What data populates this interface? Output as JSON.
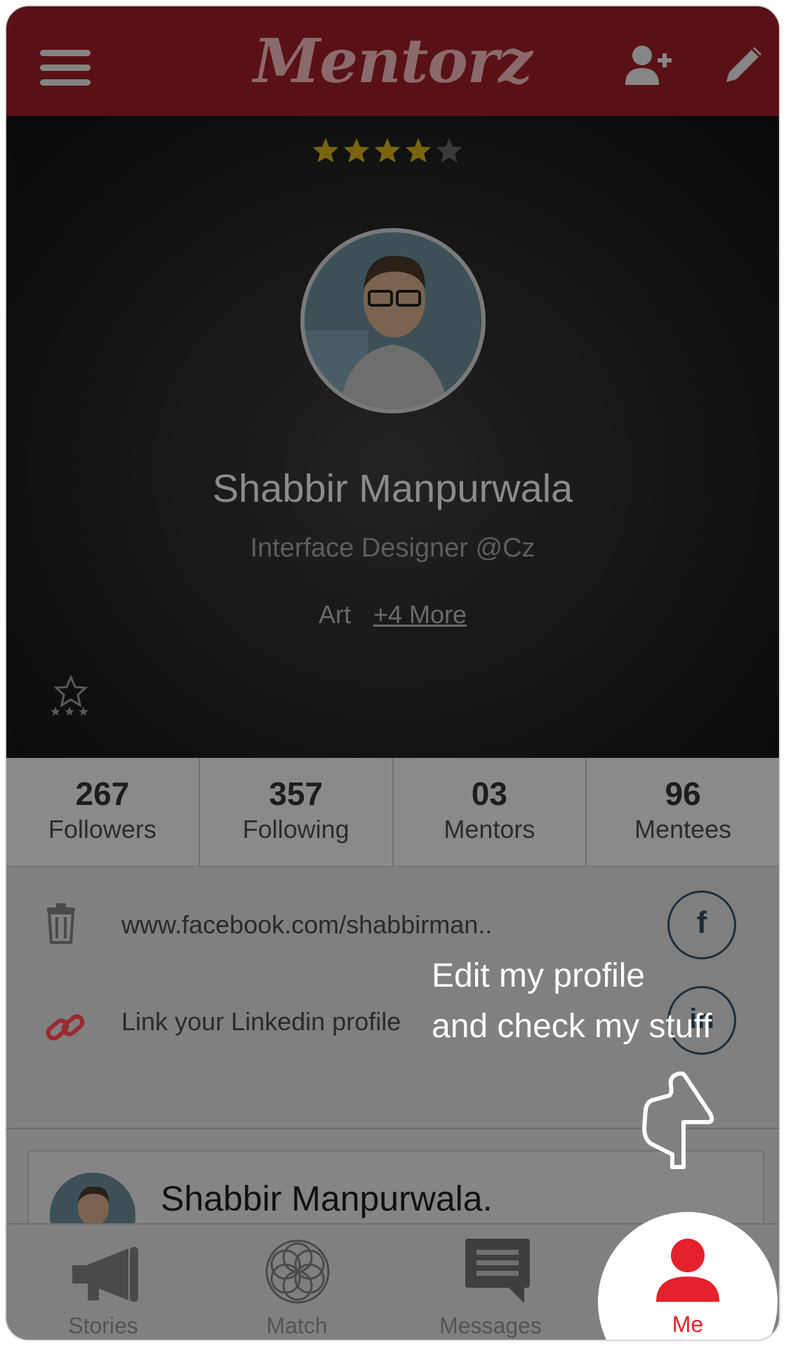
{
  "header": {
    "logo": "Mentorz",
    "menu_icon": "hamburger-icon",
    "add_user_icon": "add-user-icon",
    "edit_icon": "pencil-icon"
  },
  "profile": {
    "rating": 4,
    "rating_max": 5,
    "name": "Shabbir Manpurwala",
    "role": "Interface Designer @Cz",
    "tag": "Art",
    "more_tags": "+4 More",
    "badge_icon": "star-badge-icon"
  },
  "stats": [
    {
      "value": "267",
      "label": "Followers"
    },
    {
      "value": "357",
      "label": "Following"
    },
    {
      "value": "03",
      "label": "Mentors"
    },
    {
      "value": "96",
      "label": "Mentees"
    }
  ],
  "links": {
    "facebook_url": "www.facebook.com/shabbirman..",
    "linkedin_text": "Link your Linkedin profile",
    "facebook_glyph": "f",
    "linkedin_glyph": "in"
  },
  "card": {
    "name": "Shabbir Manpurwala."
  },
  "tooltip": {
    "line1": "Edit my profile",
    "line2": "and check my stuff"
  },
  "bottom_nav": [
    {
      "label": "Stories",
      "icon": "megaphone-icon"
    },
    {
      "label": "Match",
      "icon": "match-icon"
    },
    {
      "label": "Messages",
      "icon": "messages-icon"
    },
    {
      "label": "Me",
      "icon": "person-icon"
    }
  ],
  "colors": {
    "header": "#5a1115",
    "accent": "#e5212b",
    "star_active": "#7a6410",
    "overlay": "#808080"
  }
}
